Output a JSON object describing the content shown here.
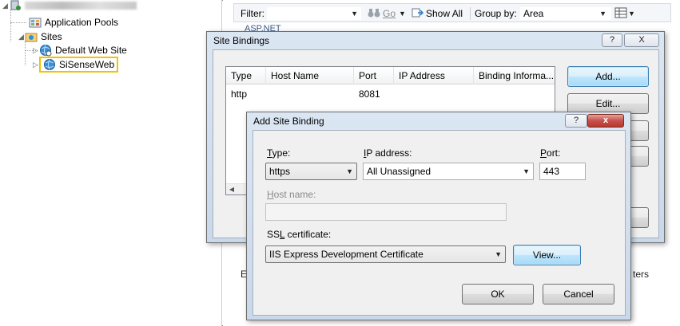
{
  "tree": {
    "root_label": "",
    "app_pools": "Application Pools",
    "sites": "Sites",
    "default_site": "Default Web Site",
    "sisense": "SiSenseWeb"
  },
  "filterbar": {
    "filter_label": "Filter:",
    "go_label": "Go",
    "show_all": "Show All",
    "group_by": "Group by:",
    "group_value": "Area"
  },
  "background": {
    "asp_net": "ASP.NET",
    "e_fragment": "E",
    "ters_fragment": "ters"
  },
  "site_bindings": {
    "title": "Site Bindings",
    "help": "?",
    "close": "X",
    "columns": [
      "Type",
      "Host Name",
      "Port",
      "IP Address",
      "Binding Informa..."
    ],
    "rows": [
      {
        "type": "http",
        "host": "",
        "port": "8081",
        "ip": "",
        "info": ""
      }
    ],
    "add_button": "Add...",
    "edit_button": "Edit..."
  },
  "add_binding": {
    "title": "Add Site Binding",
    "help": "?",
    "close": "x",
    "type_label_u": "T",
    "type_label_rest": "ype:",
    "type_value": "https",
    "ip_label_u": "I",
    "ip_label_rest": "P address:",
    "ip_value": "All Unassigned",
    "port_label_u": "P",
    "port_label_rest": "ort:",
    "port_value": "443",
    "host_label_u": "H",
    "host_label_rest": "ost name:",
    "host_value": "",
    "ssl_label_pre": "SS",
    "ssl_label_u": "L",
    "ssl_label_rest": " certificate:",
    "ssl_value": "IIS Express Development Certificate",
    "view_button": "View...",
    "ok_button": "OK",
    "cancel_button": "Cancel"
  }
}
